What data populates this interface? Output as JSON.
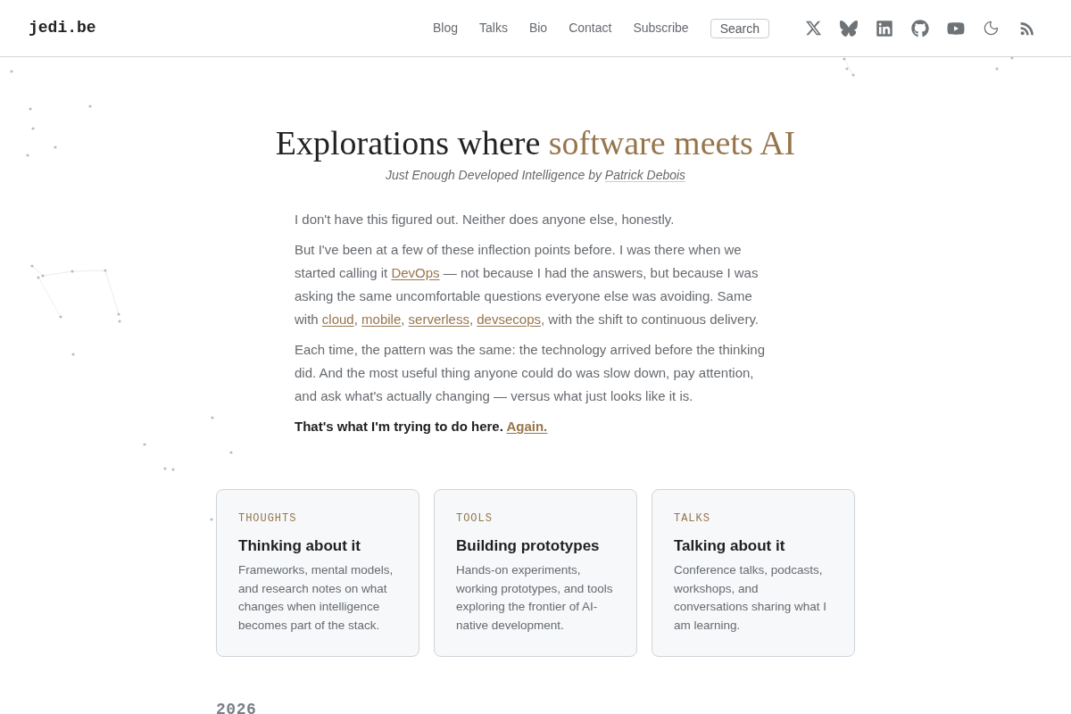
{
  "header": {
    "logo": "jedi.be",
    "nav": [
      {
        "label": "Blog"
      },
      {
        "label": "Talks"
      },
      {
        "label": "Bio"
      },
      {
        "label": "Contact"
      },
      {
        "label": "Subscribe"
      }
    ],
    "search_button": "Search"
  },
  "hero": {
    "title": "Explorations where",
    "title_highlight": "software meets AI",
    "tagline": "Just Enough Developed Intelligence by",
    "author": "Patrick Debois"
  },
  "intro": [
    {
      "segments": [
        {
          "kind": "text",
          "text": "I don't have this figured out. Neither does anyone else, honestly."
        }
      ]
    },
    {
      "segments": [
        {
          "kind": "text",
          "text": "But I've been at a few of these inflection points before. I was there when we started calling it "
        },
        {
          "kind": "link",
          "text": "DevOps"
        },
        {
          "kind": "text",
          "text": " — not because I had the answers, but because I was asking the same uncomfortable questions everyone else was avoiding. Same with "
        },
        {
          "kind": "link",
          "text": "cloud"
        },
        {
          "kind": "text",
          "text": ", "
        },
        {
          "kind": "link",
          "text": "mobile"
        },
        {
          "kind": "text",
          "text": ", "
        },
        {
          "kind": "link",
          "text": "serverless"
        },
        {
          "kind": "text",
          "text": ", "
        },
        {
          "kind": "link",
          "text": "devsecops"
        },
        {
          "kind": "text",
          "text": ", with the shift to continuous delivery."
        }
      ]
    },
    {
      "segments": [
        {
          "kind": "text",
          "text": "Each time, the pattern was the same: the technology arrived before the thinking did. And the most useful thing anyone could do was slow down, pay attention, and ask what's actually changing — versus what just looks like it is."
        }
      ]
    }
  ],
  "closing": {
    "text": "That's what I'm trying to do here.",
    "link": "Again."
  },
  "cards": [
    {
      "label": "THOUGHTS",
      "title": "Thinking about it",
      "description": "Frameworks, mental models, and research notes on what changes when intelligence becomes part of the stack."
    },
    {
      "label": "TOOLS",
      "title": "Building prototypes",
      "description": "Hands-on experiments, working prototypes, and tools exploring the frontier of AI-native development."
    },
    {
      "label": "TALKS",
      "title": "Talking about it",
      "description": "Conference talks, podcasts, workshops, and conversations sharing what I am learning."
    }
  ],
  "section_heading": "2026"
}
